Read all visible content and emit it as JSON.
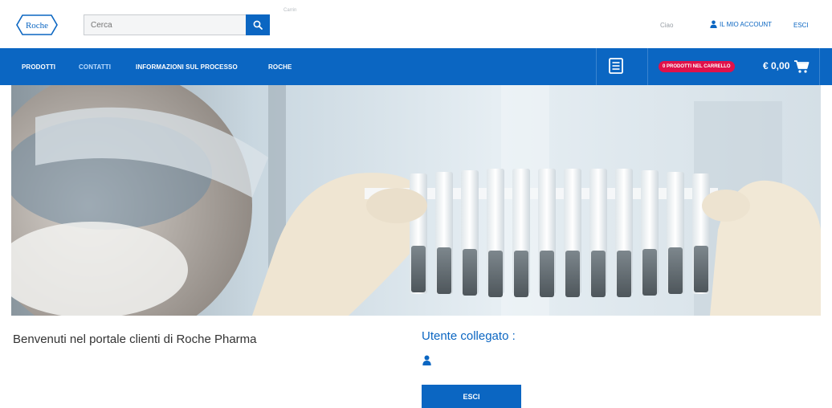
{
  "header": {
    "logo_text": "Roche",
    "search_placeholder": "Cerca",
    "tiny_label": "Carrin",
    "greeting": "Ciao",
    "account_label": "IL MIO ACCOUNT",
    "logout_label": "ESCI"
  },
  "nav": {
    "items": [
      {
        "label": "PRODOTTI"
      },
      {
        "label": "CONTATTI"
      },
      {
        "label": "INFORMAZIONI SUL PROCESSO"
      },
      {
        "label": "ROCHE"
      }
    ],
    "cart_badge": "0 PRODOTTI NEL CARRELLO",
    "cart_total": "€ 0,00"
  },
  "main": {
    "welcome": "Benvenuti nel portale clienti di Roche Pharma",
    "user_heading": "Utente collegato :",
    "logout_button": "ESCI"
  },
  "colors": {
    "brand_blue": "#0b66c2",
    "badge_red": "#e0114a"
  }
}
